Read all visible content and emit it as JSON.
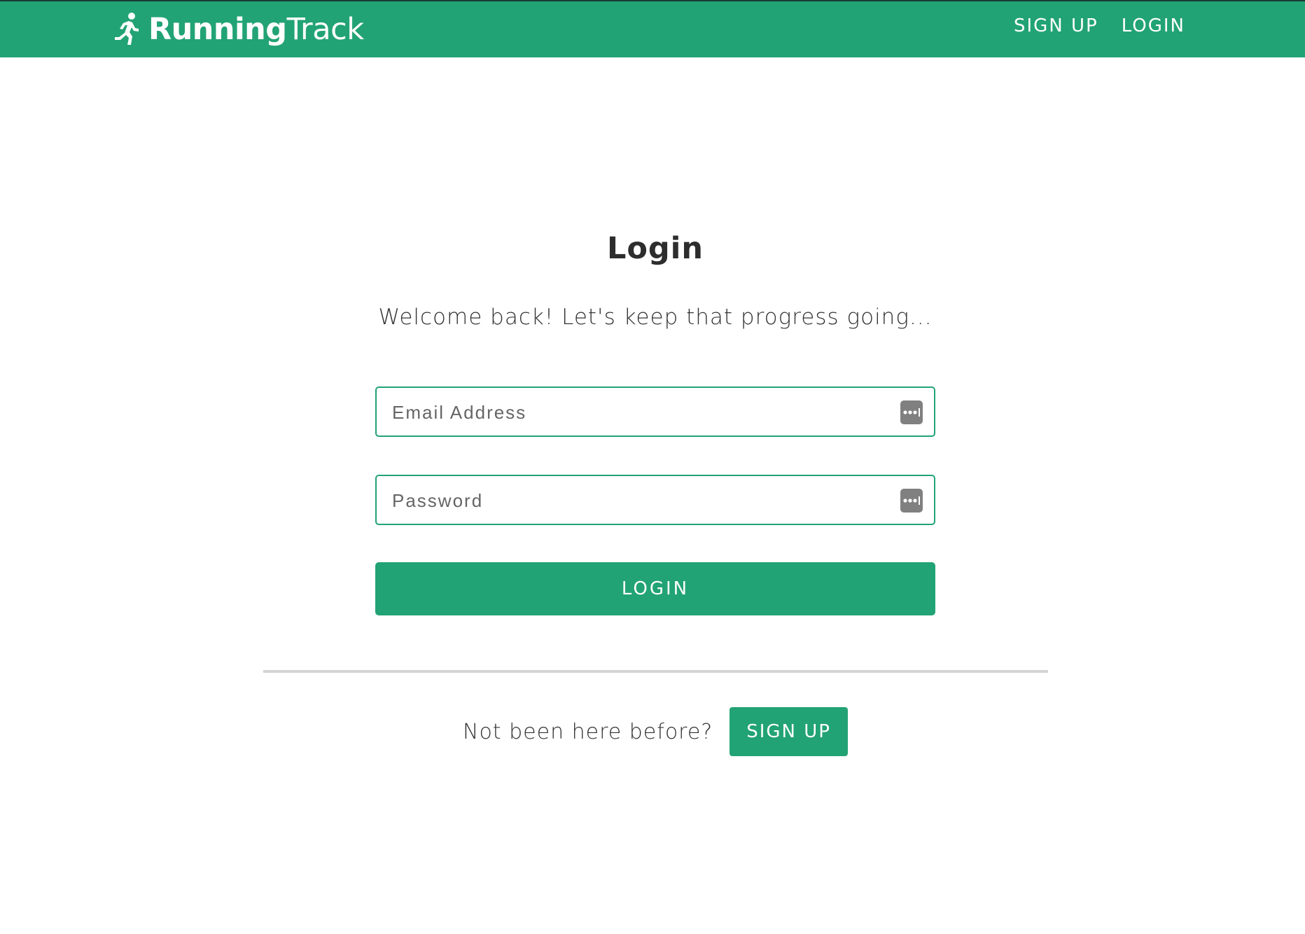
{
  "header": {
    "brand": {
      "bold": "Running",
      "light": "Track"
    },
    "nav": {
      "signup_label": "SIGN UP",
      "login_label": "LOGIN"
    }
  },
  "main": {
    "title": "Login",
    "subtitle": "Welcome back! Let's keep that progress going...",
    "email": {
      "placeholder": "Email Address",
      "value": ""
    },
    "password": {
      "placeholder": "Password",
      "value": ""
    },
    "login_button_label": "LOGIN",
    "signup_prompt": "Not been here before?",
    "signup_button_label": "SIGN UP"
  },
  "icons": {
    "brand_icon": "running-person-icon",
    "field_icon": "password-manager-key-icon"
  },
  "colors": {
    "accent": "#22a375",
    "divider": "#d4d4d4",
    "text": "#333333",
    "field_icon_bg": "#808080"
  }
}
